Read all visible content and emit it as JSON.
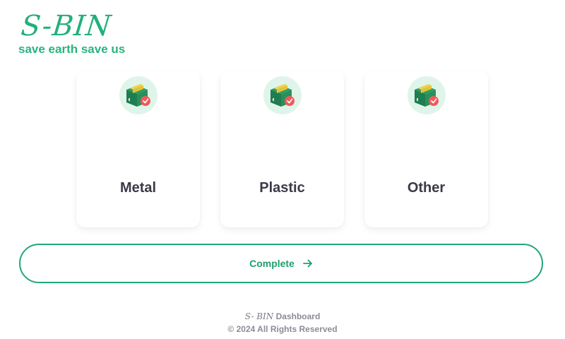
{
  "brand": {
    "logo": "S-BIN",
    "tagline": "save earth save us"
  },
  "categories": [
    {
      "label": "Metal",
      "icon": "package-check-icon"
    },
    {
      "label": "Plastic",
      "icon": "package-check-icon"
    },
    {
      "label": "Other",
      "icon": "package-check-icon"
    }
  ],
  "complete_button": {
    "label": "Complete",
    "icon": "arrow-right-icon"
  },
  "footer": {
    "logo": "S- BIN",
    "dashboard": "Dashboard",
    "copyright": "© 2024 All Rights Reserved"
  },
  "colors": {
    "accent": "#22b07a",
    "icon_bg": "#dff5ea",
    "card_text": "#3a3a48",
    "footer_text": "#8c8c96"
  }
}
